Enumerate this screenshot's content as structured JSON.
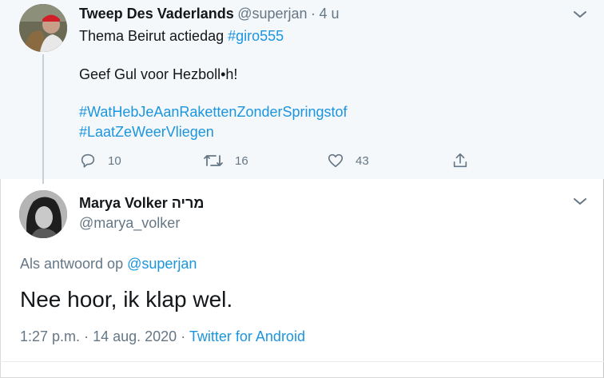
{
  "parent_tweet": {
    "display_name": "Tweep Des Vaderlands",
    "handle": "@superjan",
    "separator": "·",
    "time_ago": "4 u",
    "line1_text": "Thema Beirut actiedag ",
    "line1_hashtag": "#giro555",
    "line2": "Geef Gul voor Hezboll•h!",
    "hashtag1": "#WatHebJeAanRakettenZonderSpringstof",
    "hashtag2": "#LaatZeWeerVliegen",
    "reply_count": "10",
    "retweet_count": "16",
    "like_count": "43"
  },
  "focused_tweet": {
    "display_name": "Marya Volker מריה",
    "handle": "@marya_volker",
    "reply_prefix": "Als antwoord op ",
    "reply_handle": "@superjan",
    "text": "Nee hoor, ik klap wel.",
    "time": "1:27 p.m.",
    "dot1": "·",
    "date": "14 aug. 2020",
    "dot2": "·",
    "source": "Twitter for Android"
  },
  "colors": {
    "link": "#1b95e0",
    "secondary_text": "#657786",
    "parent_background": "#f5f8fa"
  }
}
